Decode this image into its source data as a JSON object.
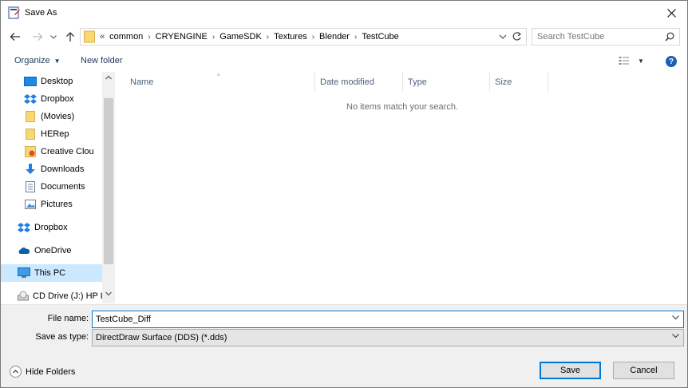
{
  "window": {
    "title": "Save As"
  },
  "address": {
    "overflow": "«",
    "crumbs": [
      "common",
      "CRYENGINE",
      "GameSDK",
      "Textures",
      "Blender",
      "TestCube"
    ]
  },
  "search": {
    "placeholder": "Search TestCube"
  },
  "commands": {
    "organize": "Organize",
    "new_folder": "New folder"
  },
  "nav": {
    "items": [
      {
        "label": "Desktop",
        "icon": "desktop-icon",
        "pinned": true
      },
      {
        "label": "Dropbox",
        "icon": "dropbox-icon",
        "pinned": true
      },
      {
        "label": "(Movies)",
        "icon": "folder-icon",
        "pinned": true
      },
      {
        "label": "HERep",
        "icon": "folder-icon",
        "pinned": true
      },
      {
        "label": "Creative Clou",
        "icon": "creative-cloud-icon",
        "pinned": true
      },
      {
        "label": "Downloads",
        "icon": "download-icon",
        "pinned": true
      },
      {
        "label": "Documents",
        "icon": "documents-icon",
        "pinned": true
      },
      {
        "label": "Pictures",
        "icon": "pictures-icon",
        "pinned": true
      },
      {
        "label": "Dropbox",
        "icon": "dropbox-icon",
        "pinned": false
      },
      {
        "label": "OneDrive",
        "icon": "onedrive-icon",
        "pinned": false
      },
      {
        "label": "This PC",
        "icon": "computer-icon",
        "pinned": false,
        "selected": true
      },
      {
        "label": "CD Drive (J:) HP L",
        "icon": "cd-drive-icon",
        "pinned": false
      }
    ]
  },
  "columns": [
    "Name",
    "Date modified",
    "Type",
    "Size"
  ],
  "empty_message": "No items match your search.",
  "form": {
    "file_name_label": "File name:",
    "file_name_value": "TestCube_Diff",
    "save_type_label": "Save as type:",
    "save_type_value": "DirectDraw Surface (DDS) (*.dds)"
  },
  "buttons": {
    "hide_folders": "Hide Folders",
    "save": "Save",
    "cancel": "Cancel"
  },
  "colors": {
    "accent": "#0078d7",
    "selected": "#cce8ff"
  }
}
